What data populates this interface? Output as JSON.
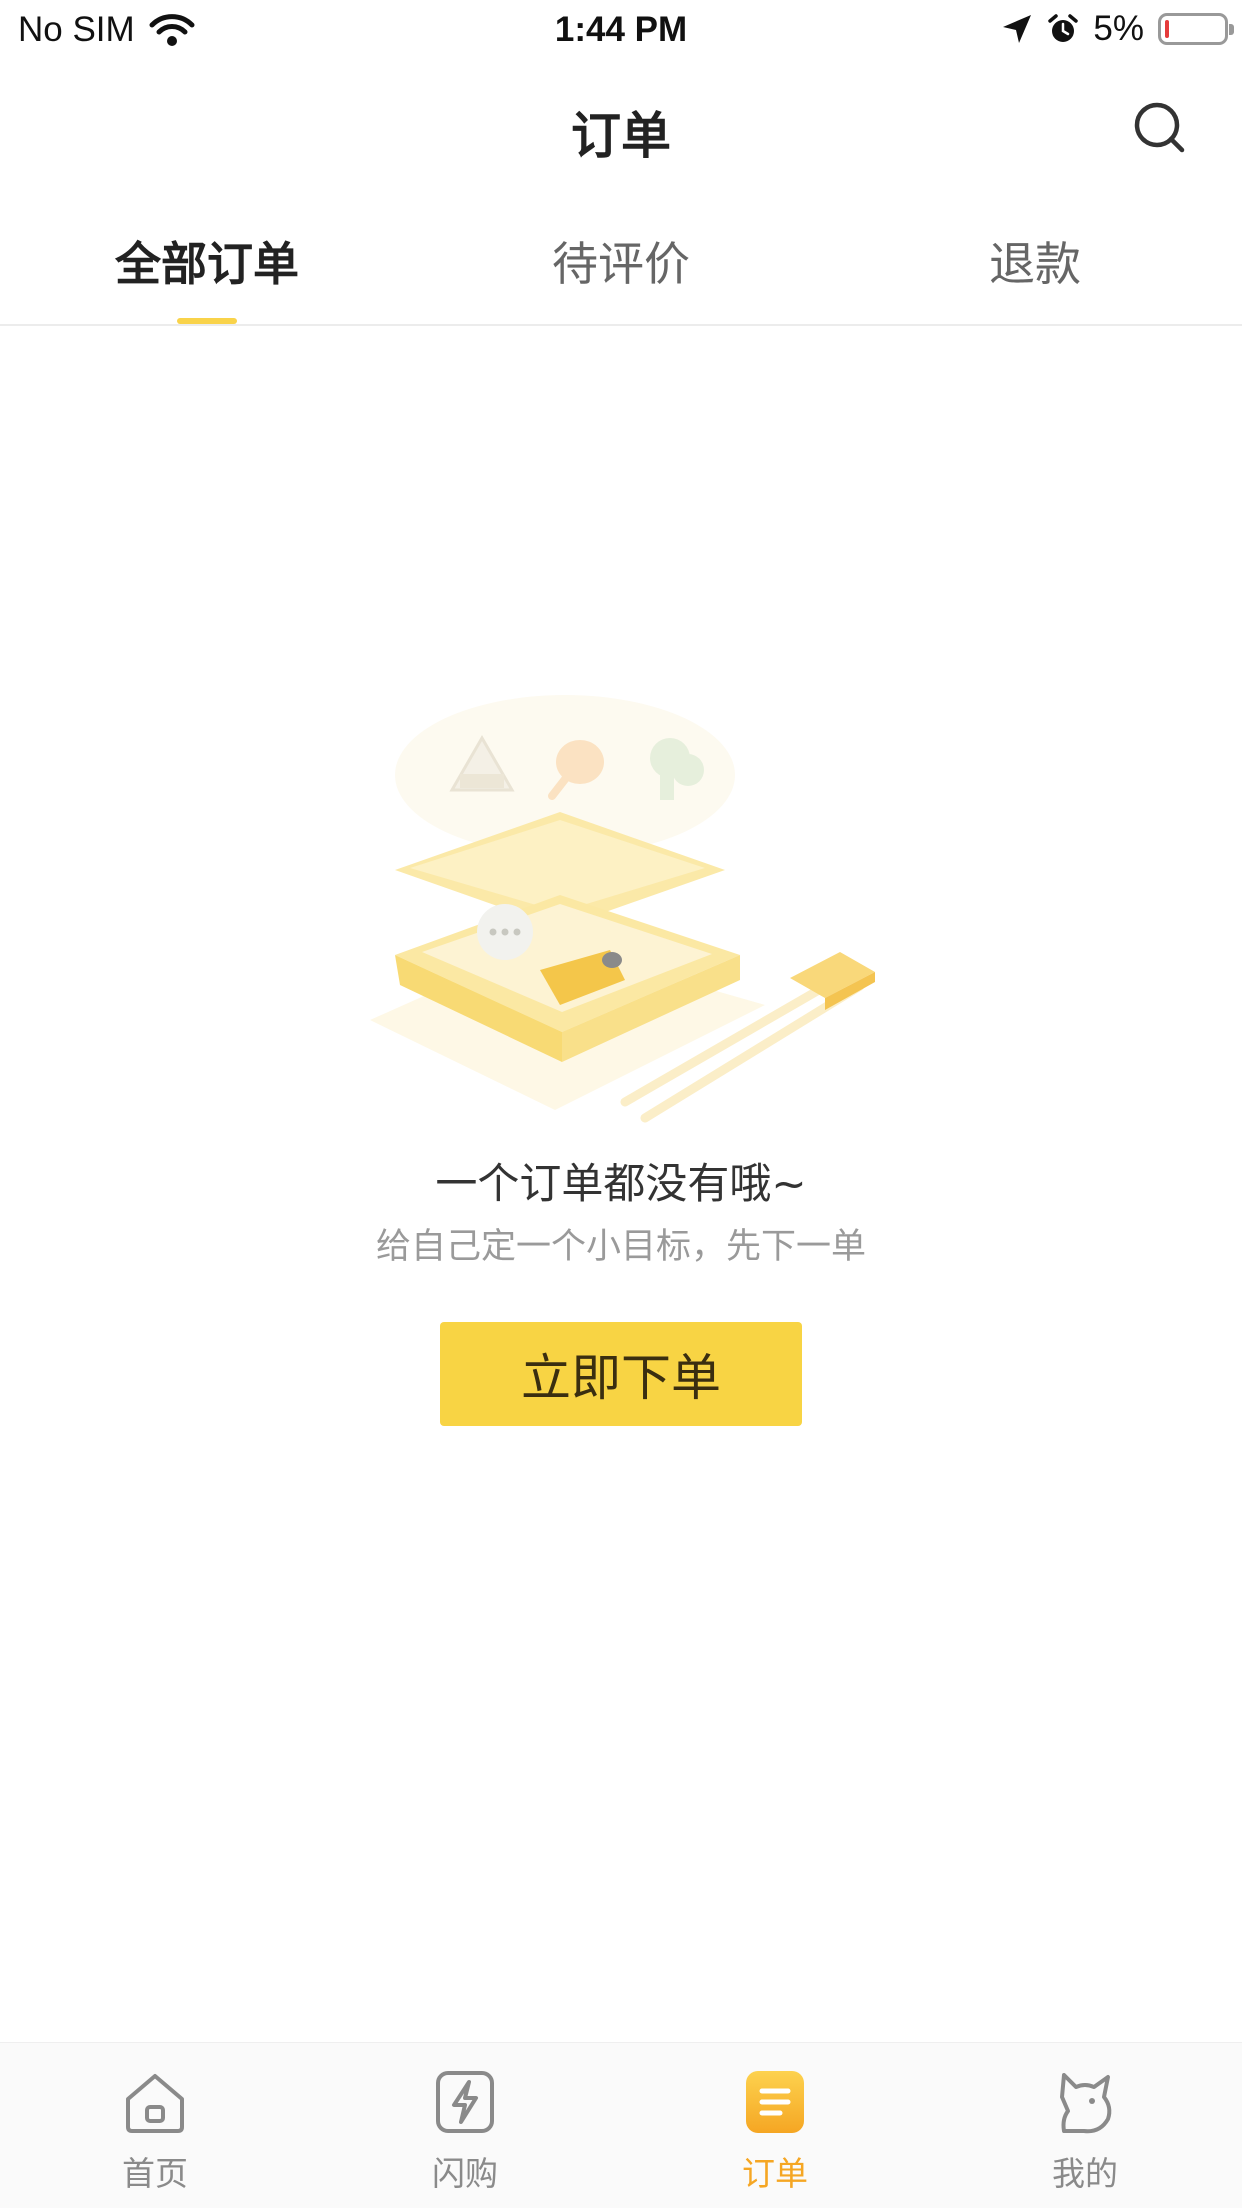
{
  "status_bar": {
    "carrier": "No SIM",
    "time": "1:44 PM",
    "battery": "5%"
  },
  "nav": {
    "title": "订单"
  },
  "tabs": [
    {
      "label": "全部订单",
      "active": true
    },
    {
      "label": "待评价",
      "active": false
    },
    {
      "label": "退款",
      "active": false
    }
  ],
  "empty_state": {
    "title": "一个订单都没有哦~",
    "subtitle": "给自己定一个小目标，先下一单",
    "button_label": "立即下单"
  },
  "tab_bar": {
    "items": [
      {
        "label": "首页",
        "icon": "home-icon",
        "active": false
      },
      {
        "label": "闪购",
        "icon": "lightning-icon",
        "active": false
      },
      {
        "label": "订单",
        "icon": "orders-icon",
        "active": true
      },
      {
        "label": "我的",
        "icon": "profile-icon",
        "active": false
      }
    ]
  },
  "colors": {
    "accent": "#f8d444",
    "active_tab": "#f5a623",
    "low_battery": "#e53b3b"
  }
}
